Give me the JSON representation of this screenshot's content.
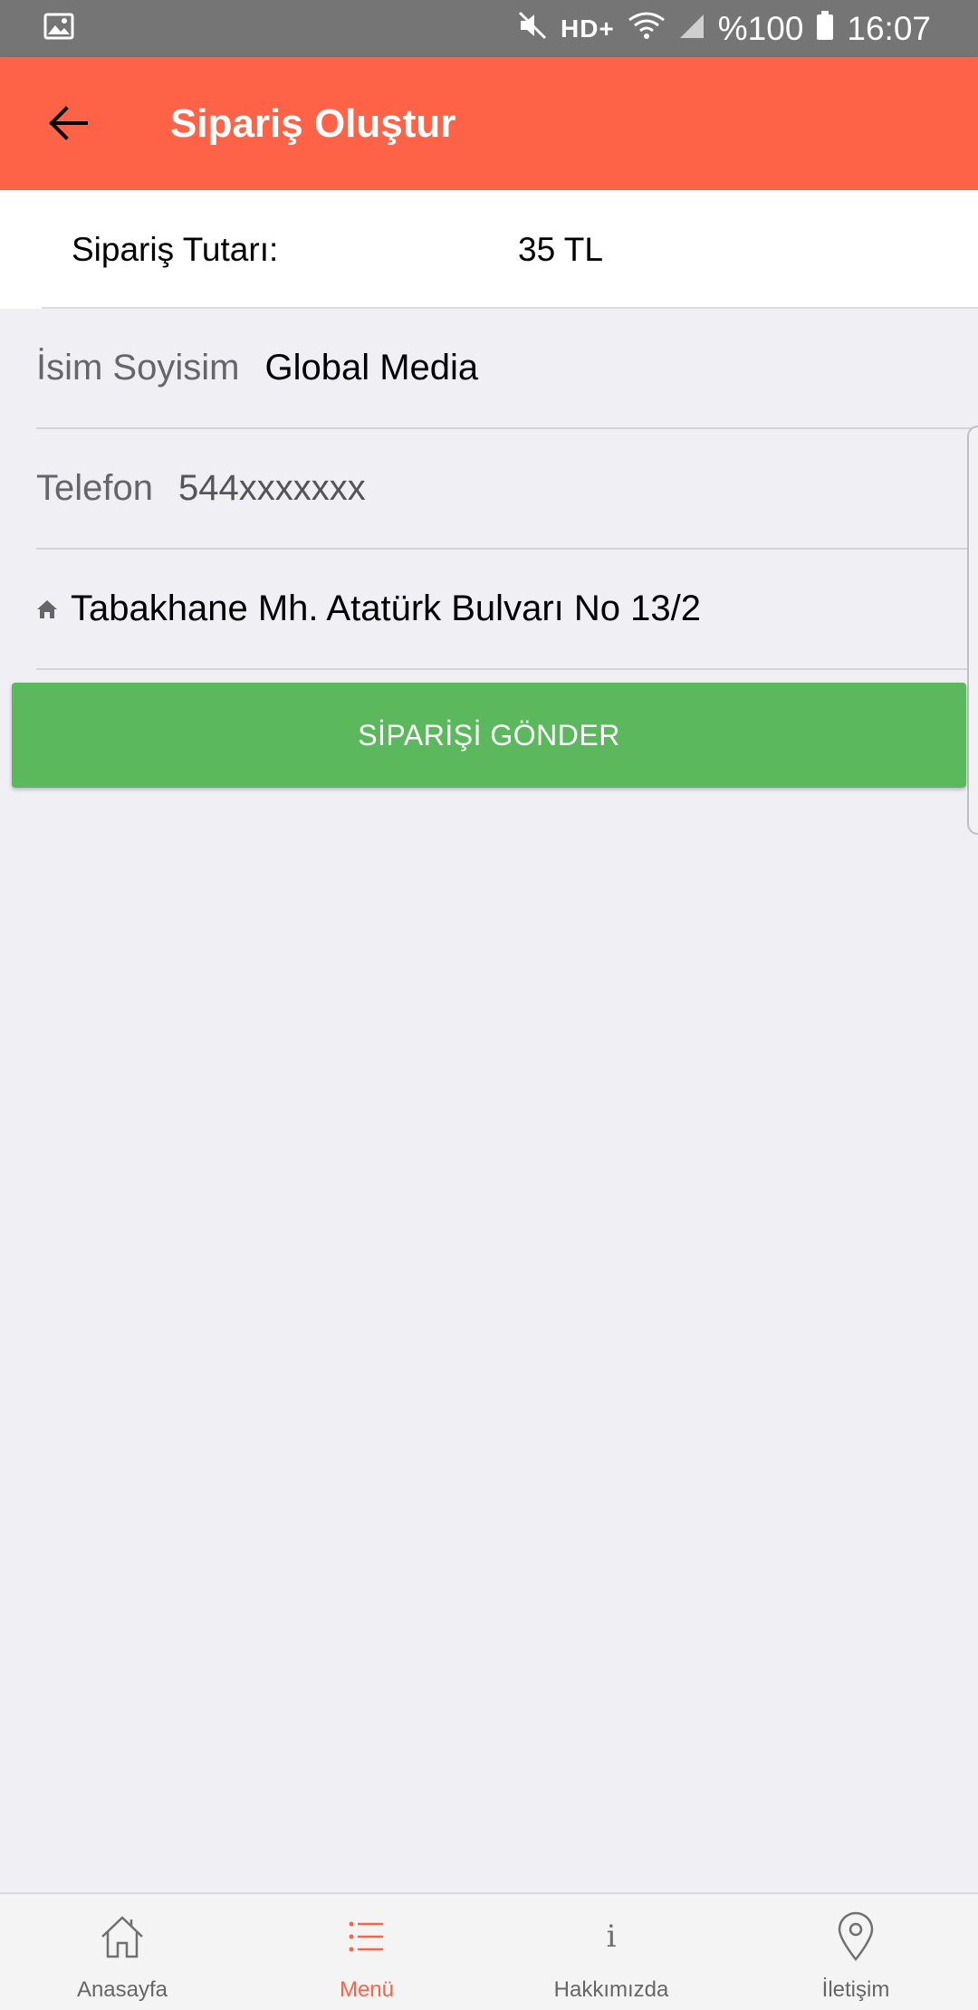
{
  "status_bar": {
    "hd_label": "HD+",
    "battery_text": "%100",
    "time": "16:07",
    "icons": [
      "image-notification-icon",
      "mute-icon",
      "wifi-icon",
      "signal-icon",
      "battery-icon"
    ]
  },
  "app_bar": {
    "title": "Sipariş Oluştur",
    "background_color": "#ff6347"
  },
  "order": {
    "total_label": "Sipariş Tutarı:",
    "total_value": "35 TL"
  },
  "form": {
    "name_label": "İsim Soyisim",
    "name_value": "Global Media",
    "phone_label": "Telefon",
    "phone_value": "544xxxxxxx",
    "address_value": "Tabakhane Mh. Atatürk Bulvarı No 13/2"
  },
  "submit": {
    "label": "SİPARİŞİ GÖNDER",
    "color": "#5cb85c"
  },
  "bottom_nav": {
    "items": [
      {
        "label": "Anasayfa",
        "icon": "home-icon"
      },
      {
        "label": "Menü",
        "icon": "list-icon",
        "active": true
      },
      {
        "label": "Hakkımızda",
        "icon": "info-icon"
      },
      {
        "label": "İletişim",
        "icon": "location-pin-icon"
      }
    ],
    "active_color": "#ff6347"
  }
}
